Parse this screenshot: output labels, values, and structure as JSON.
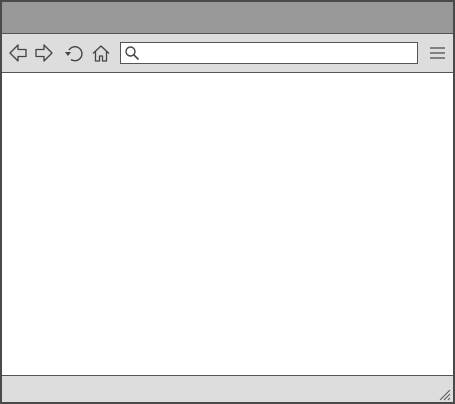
{
  "window": {
    "title": ""
  },
  "toolbar": {
    "icons": [
      "back-arrow-icon",
      "forward-arrow-icon",
      "reload-icon",
      "home-icon",
      "hamburger-menu-icon"
    ]
  },
  "address_bar": {
    "value": "",
    "placeholder": "",
    "icon": "search-icon"
  },
  "status_bar": {
    "text": ""
  },
  "colors": {
    "titlebar": "#999999",
    "toolbar": "#dddddd",
    "statusbar": "#dddddd",
    "border": "#4a4a4a",
    "icon_stroke": "#444444",
    "content": "#ffffff"
  }
}
